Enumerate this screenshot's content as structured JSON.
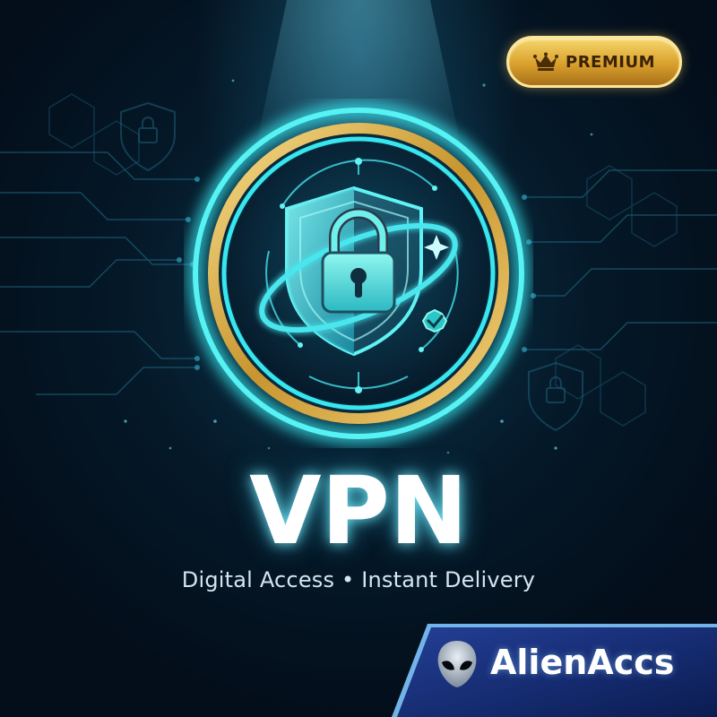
{
  "badge": {
    "label": "PREMIUM",
    "icon": "crown-icon"
  },
  "hero": {
    "title": "VPN",
    "subtitle": "Digital Access • Instant Delivery"
  },
  "emblem": {
    "icons": [
      "shield-icon",
      "lock-icon",
      "sparkle-icon",
      "check-badge-icon"
    ]
  },
  "brand": {
    "name": "AlienAccs",
    "icon": "alien-icon"
  },
  "colors": {
    "background": "#03101c",
    "teal_glow": "#38e3e8",
    "gold": "#e0b24a",
    "brand_blue": "#1d3a8a",
    "text_white": "#ffffff"
  }
}
